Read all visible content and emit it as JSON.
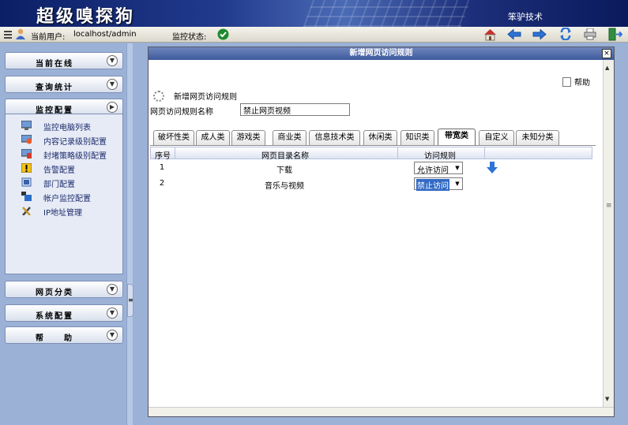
{
  "header": {
    "app_title": "超级嗅探狗",
    "company": "笨驴技术"
  },
  "toolbar": {
    "current_user_label": "当前用户:",
    "current_user_value": "localhost/admin",
    "monitor_status_label": "监控状态:"
  },
  "sidebar": {
    "sections_top": [
      {
        "label": "当前在线",
        "arrow": "▼"
      },
      {
        "label": "查询统计",
        "arrow": "▼"
      },
      {
        "label": "监控配置",
        "arrow": "▶"
      }
    ],
    "monitor_items": [
      {
        "label": "监控电脑列表",
        "icon": "monitor-icon"
      },
      {
        "label": "内容记录级别配置",
        "icon": "record-config-icon"
      },
      {
        "label": "封堵策略级别配置",
        "icon": "block-policy-icon"
      },
      {
        "label": "告警配置",
        "icon": "warning-icon"
      },
      {
        "label": "部门配置",
        "icon": "department-icon"
      },
      {
        "label": "帐户监控配置",
        "icon": "account-icon"
      },
      {
        "label": "IP地址管理",
        "icon": "tools-icon"
      }
    ],
    "sections_bottom": [
      {
        "label": "网页分类",
        "arrow": "▼"
      },
      {
        "label": "系统配置",
        "arrow": "▼"
      },
      {
        "label": "帮　　助",
        "arrow": "▼"
      }
    ]
  },
  "dialog": {
    "title": "新增网页访问规则",
    "help_label": "帮助",
    "section_label": "新增网页访问规则",
    "name_label": "网页访问规则名称",
    "name_value": "禁止网页视频",
    "tabs": [
      "破坏性类",
      "成人类",
      "游戏类",
      "商业类",
      "信息技术类",
      "休闲类",
      "知识类",
      "带宽类",
      "自定义",
      "未知分类"
    ],
    "active_tab": "带宽类",
    "columns": [
      "序号",
      "网页目录名称",
      "访问规则"
    ],
    "rows": [
      {
        "index": "1",
        "name": "下载",
        "rule": "允许访问",
        "highlighted": false
      },
      {
        "index": "2",
        "name": "音乐与视频",
        "rule": "禁止访问",
        "highlighted": true
      }
    ]
  }
}
